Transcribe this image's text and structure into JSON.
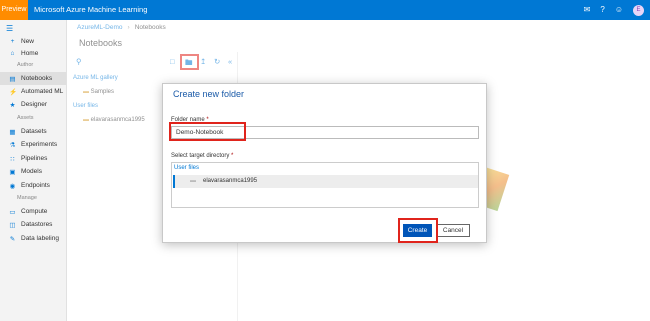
{
  "topbar": {
    "preview_badge": "Preview",
    "app_title": "Microsoft Azure Machine Learning",
    "icons": [
      "feedback-icon",
      "help-icon",
      "smiley-icon",
      "avatar-icon"
    ],
    "avatar_letter": "E"
  },
  "sidebar": {
    "new": "New",
    "home": "Home",
    "section_author": "Author",
    "notebooks": "Notebooks",
    "automated_ml": "Automated ML",
    "designer": "Designer",
    "section_assets": "Assets",
    "datasets": "Datasets",
    "experiments": "Experiments",
    "pipelines": "Pipelines",
    "models": "Models",
    "endpoints": "Endpoints",
    "section_manage": "Manage",
    "compute": "Compute",
    "datastores": "Datastores",
    "data_labeling": "Data labeling"
  },
  "breadcrumb": {
    "workspace": "AzureML-Demo",
    "current": "Notebooks"
  },
  "page_title": "Notebooks",
  "tree": {
    "gallery_header": "Azure ML gallery",
    "samples": "Samples",
    "user_files_header": "User files",
    "user_folder": "elavarasanmca1995"
  },
  "dialog": {
    "title": "Create new folder",
    "folder_name_label": "Folder name",
    "required_mark": "*",
    "folder_name_value": "Demo-Notebook",
    "target_dir_label": "Select target directory",
    "user_files_label": "User files",
    "selected_folder": "elavarasanmca1995",
    "create_label": "Create",
    "cancel_label": "Cancel"
  },
  "colors": {
    "accent": "#0078d4",
    "preview": "#ff8c00",
    "highlight_box": "#e0241c",
    "primary_button": "#0055b8"
  }
}
